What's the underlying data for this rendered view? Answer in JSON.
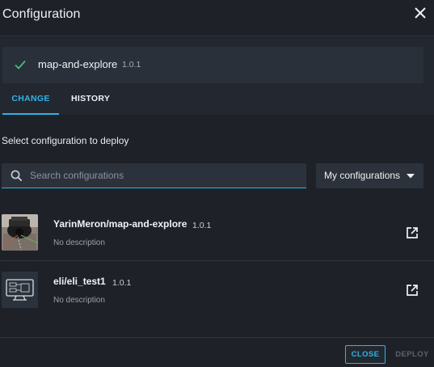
{
  "dialog": {
    "title": "Configuration"
  },
  "current": {
    "name": "map-and-explore",
    "version": "1.0.1",
    "status_icon": "check-icon",
    "status_color": "#3fc27a"
  },
  "tabs": [
    {
      "label": "CHANGE",
      "active": true
    },
    {
      "label": "HISTORY",
      "active": false
    }
  ],
  "section_label": "Select configuration to deploy",
  "search": {
    "placeholder": "Search configurations",
    "value": ""
  },
  "filter": {
    "selected": "My configurations"
  },
  "configurations": [
    {
      "name": "YarinMeron/map-and-explore",
      "version": "1.0.1",
      "description": "No description",
      "thumbnail": "robot-photo"
    },
    {
      "name": "eli/eli_test1",
      "version": "1.0.1",
      "description": "No description",
      "thumbnail": "monitor-icon"
    }
  ],
  "footer": {
    "close_label": "CLOSE",
    "deploy_label": "DEPLOY"
  },
  "colors": {
    "accent": "#2fb3e6",
    "background": "#1e2228",
    "success": "#3fc27a"
  }
}
